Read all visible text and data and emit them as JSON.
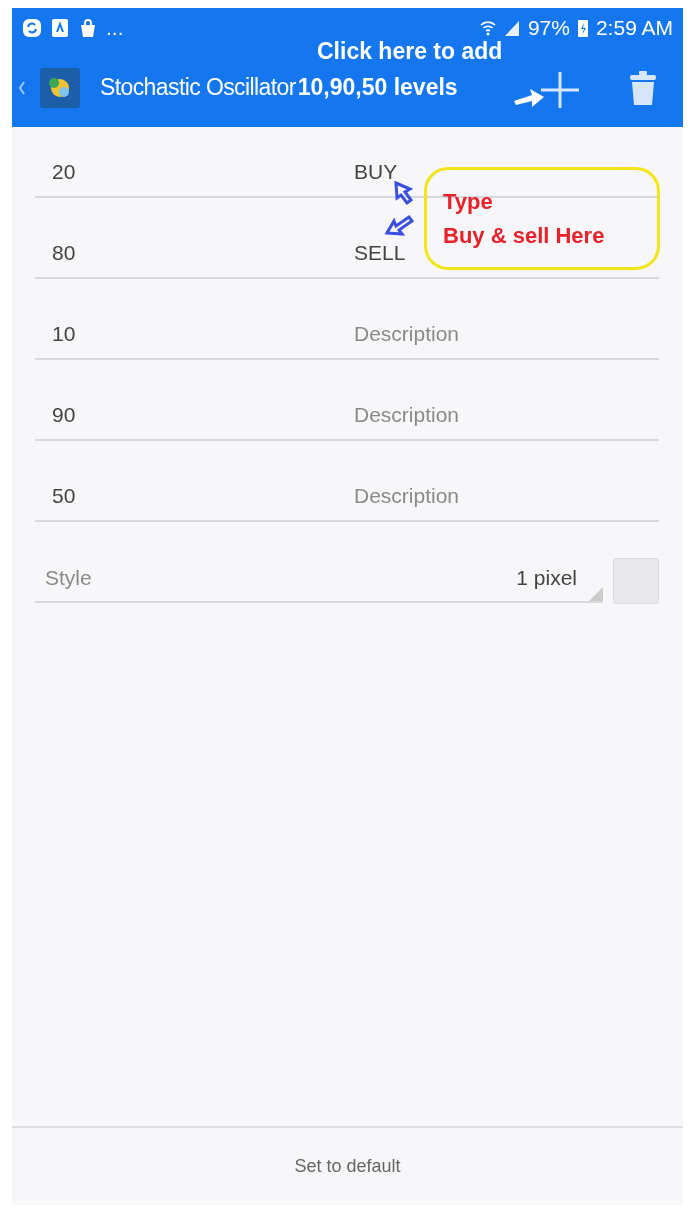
{
  "status_bar": {
    "notification_more": "...",
    "battery": "97%",
    "time": "2:59 AM"
  },
  "toolbar": {
    "title": "Stochastic Oscillator"
  },
  "annotations": {
    "header_hint": "Click here to add",
    "header_levels": "10,90,50 levels",
    "callout_line_1": "Type",
    "callout_line_2": "Buy & sell Here"
  },
  "levels": [
    {
      "value": "20",
      "description": "BUY"
    },
    {
      "value": "80",
      "description": "SELL"
    },
    {
      "value": "10",
      "placeholder": "Description"
    },
    {
      "value": "90",
      "placeholder": "Description"
    },
    {
      "value": "50",
      "placeholder": "Description"
    }
  ],
  "style": {
    "label": "Style",
    "value": "1 pixel"
  },
  "footer": {
    "button": "Set to default"
  }
}
